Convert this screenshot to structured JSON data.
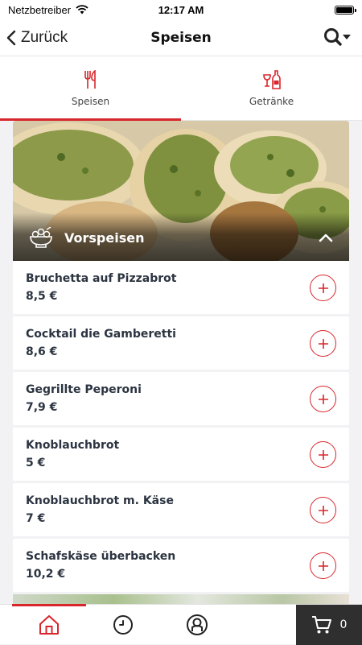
{
  "status": {
    "carrier": "Netzbetreiber",
    "time": "12:17 AM"
  },
  "nav": {
    "back_label": "Zurück",
    "title": "Speisen"
  },
  "tabs": [
    {
      "label": "Speisen",
      "icon": "cutlery-icon",
      "active": true
    },
    {
      "label": "Getränke",
      "icon": "drinks-icon",
      "active": false
    }
  ],
  "category": {
    "title": "Vorspeisen",
    "icon": "salad-bowl-icon",
    "expanded": true
  },
  "items": [
    {
      "name": "Bruchetta auf Pizzabrot",
      "price": "8,5 €"
    },
    {
      "name": "Cocktail die Gamberetti",
      "price": "8,6 €"
    },
    {
      "name": "Gegrillte Peperoni",
      "price": "7,9 €"
    },
    {
      "name": "Knoblauchbrot",
      "price": "5 €"
    },
    {
      "name": "Knoblauchbrot m. Käse",
      "price": "7 €"
    },
    {
      "name": "Schafskäse überbacken",
      "price": "10,2 €"
    }
  ],
  "bottom_nav": {
    "cart_count": "0"
  },
  "colors": {
    "accent": "#d8262c",
    "text": "#2b3440",
    "cart_bg": "#2f2f2f"
  }
}
